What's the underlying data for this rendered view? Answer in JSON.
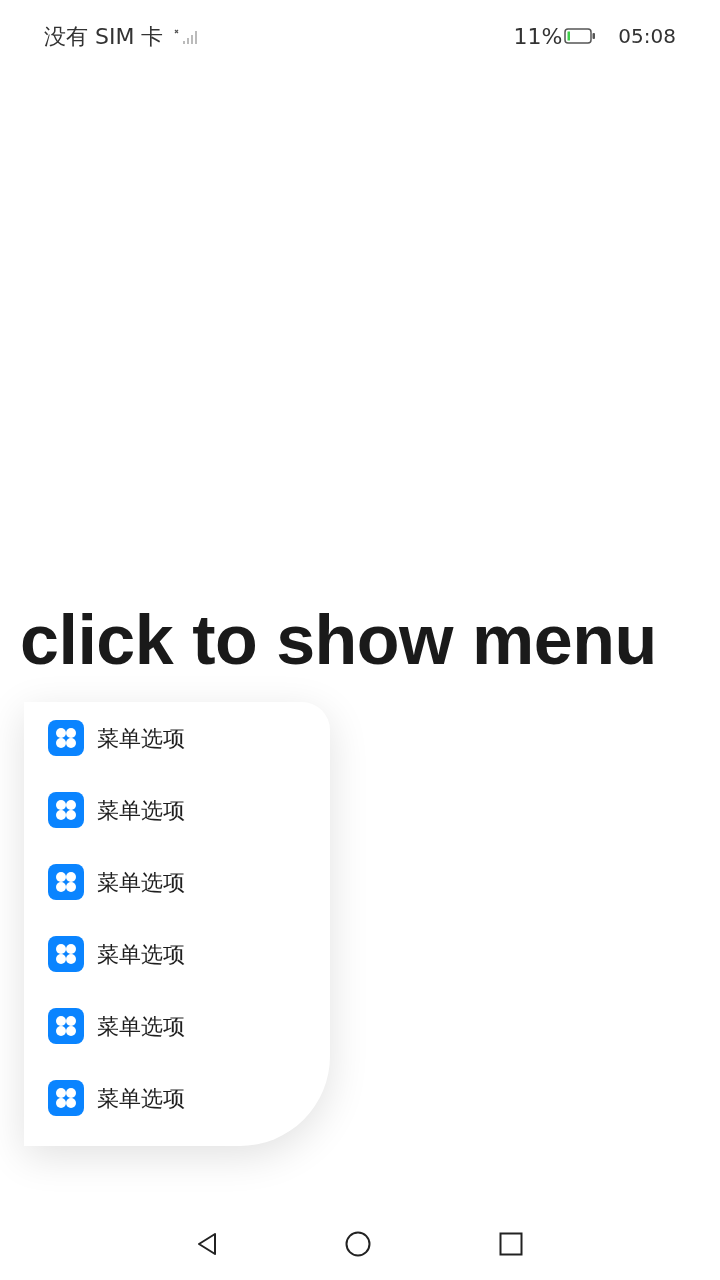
{
  "status_bar": {
    "carrier": "没有 SIM 卡",
    "battery": "11%",
    "time": "05:08"
  },
  "title": "click to show menu",
  "menu": {
    "items": [
      {
        "label": "菜单选项"
      },
      {
        "label": "菜单选项"
      },
      {
        "label": "菜单选项"
      },
      {
        "label": "菜单选项"
      },
      {
        "label": "菜单选项"
      },
      {
        "label": "菜单选项"
      }
    ]
  }
}
